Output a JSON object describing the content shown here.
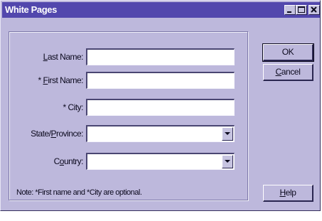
{
  "window": {
    "title": "White Pages"
  },
  "form": {
    "last_name": {
      "label_access": "L",
      "label_rest": "ast Name:",
      "value": ""
    },
    "first_name": {
      "label_prefix": "* ",
      "label_access": "F",
      "label_rest": "irst Name:",
      "value": ""
    },
    "city": {
      "label": "* City:",
      "value": ""
    },
    "state": {
      "label_pre": "State/",
      "label_access": "P",
      "label_rest": "rovince:",
      "value": ""
    },
    "country": {
      "label_pre": "C",
      "label_access": "o",
      "label_rest": "untry:",
      "value": ""
    },
    "note": "Note: *First name and *City are optional."
  },
  "buttons": {
    "ok": "OK",
    "cancel_access": "C",
    "cancel_rest": "ancel",
    "help_access": "H",
    "help_rest": "elp"
  },
  "icons": {
    "minimize": "minimize-icon",
    "maximize": "maximize-icon",
    "close": "close-icon",
    "dropdown": "dropdown-arrow-icon"
  }
}
